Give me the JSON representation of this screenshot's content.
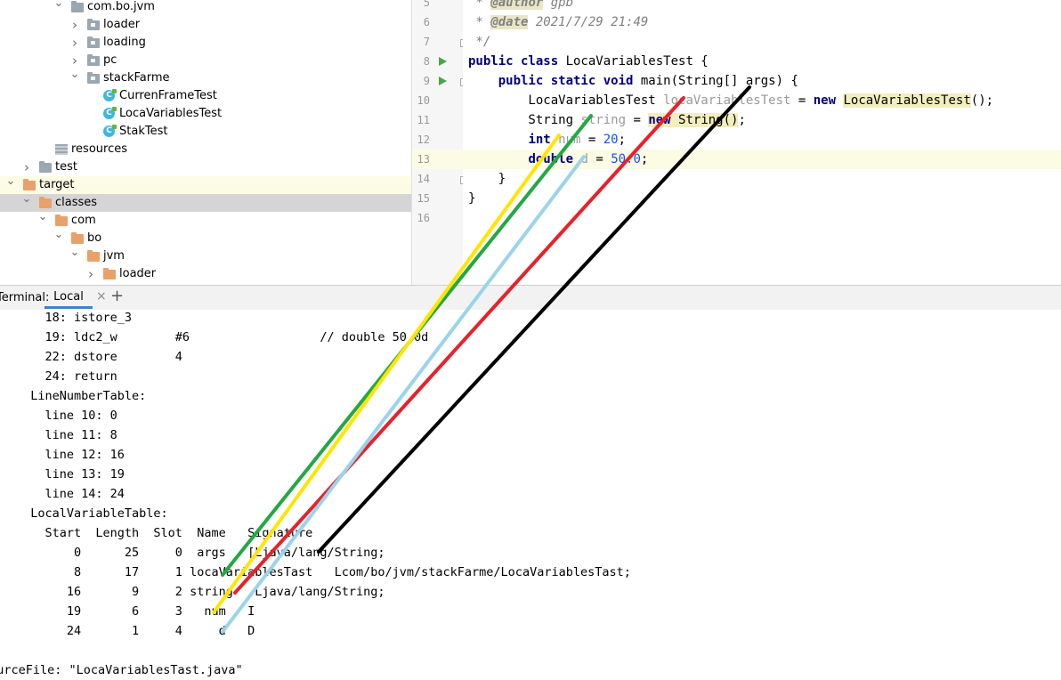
{
  "tree": [
    {
      "label": "com.bo.jvm",
      "depth": 0,
      "expanded": true,
      "icon": "folder-icon"
    },
    {
      "label": "loader",
      "depth": 1,
      "expanded": false,
      "icon": "package-icon"
    },
    {
      "label": "loading",
      "depth": 1,
      "expanded": false,
      "icon": "package-icon"
    },
    {
      "label": "pc",
      "depth": 1,
      "expanded": false,
      "icon": "package-icon"
    },
    {
      "label": "stackFarme",
      "depth": 1,
      "expanded": true,
      "icon": "package-icon"
    },
    {
      "label": "CurrenFrameTest",
      "depth": 2,
      "icon": "class-icon"
    },
    {
      "label": "LocaVariablesTest",
      "depth": 2,
      "icon": "class-icon"
    },
    {
      "label": "StakTest",
      "depth": 2,
      "icon": "class-icon"
    },
    {
      "label": "resources",
      "depth": -1,
      "icon": "resources-icon"
    },
    {
      "label": "test",
      "depth": -2,
      "expanded": false,
      "icon": "folder-icon"
    },
    {
      "label": "target",
      "depth": -3,
      "expanded": true,
      "icon": "folder-orange-icon"
    },
    {
      "label": "classes",
      "depth": -2,
      "expanded": true,
      "icon": "folder-orange-icon"
    },
    {
      "label": "com",
      "depth": -1,
      "expanded": true,
      "icon": "folder-orange-icon"
    },
    {
      "label": "bo",
      "depth": 0,
      "expanded": true,
      "icon": "folder-orange-icon"
    },
    {
      "label": "jvm",
      "depth": 1,
      "expanded": true,
      "icon": "folder-orange-icon"
    },
    {
      "label": "loader",
      "depth": 2,
      "expanded": false,
      "icon": "folder-orange-icon"
    }
  ],
  "editor": {
    "line_numbers": [
      "5",
      "6",
      "7",
      "8",
      "9",
      "10",
      "11",
      "12",
      "13",
      "14",
      "15",
      "16"
    ],
    "current_line": "13",
    "lines": [
      [
        {
          "t": " * ",
          "c": "cmt"
        },
        {
          "t": "@author",
          "c": "tag"
        },
        {
          "t": " gpb",
          "c": "cmt"
        }
      ],
      [
        {
          "t": " * ",
          "c": "cmt"
        },
        {
          "t": "@date",
          "c": "tag"
        },
        {
          "t": " 2021/7/29 21:49",
          "c": "cmt"
        }
      ],
      [
        {
          "t": " */",
          "c": "cmt"
        }
      ],
      [
        {
          "t": "public class ",
          "c": "kw"
        },
        {
          "t": "LocaVariablesTest {",
          "c": ""
        }
      ],
      [
        {
          "t": "    "
        },
        {
          "t": "public static void ",
          "c": "kw"
        },
        {
          "t": "main(String[] args) {"
        }
      ],
      [
        {
          "t": "        LocaVariablesTest "
        },
        {
          "t": "locaVariablesTest",
          "c": "unused"
        },
        {
          "t": " = "
        },
        {
          "t": "new ",
          "c": "kw"
        },
        {
          "t": "LocaVariablesTest",
          "c": "hlcls"
        },
        {
          "t": "();"
        }
      ],
      [
        {
          "t": "        String "
        },
        {
          "t": "string",
          "c": "unused"
        },
        {
          "t": " = "
        },
        {
          "t": "new ",
          "c": "kw hlcls"
        },
        {
          "t": "String()",
          "c": "hlcls"
        },
        {
          "t": ";"
        }
      ],
      [
        {
          "t": "        "
        },
        {
          "t": "int ",
          "c": "kw"
        },
        {
          "t": "num",
          "c": "unused"
        },
        {
          "t": " = "
        },
        {
          "t": "20",
          "c": "num"
        },
        {
          "t": ";"
        }
      ],
      [
        {
          "t": "        "
        },
        {
          "t": "double ",
          "c": "kw"
        },
        {
          "t": "d",
          "c": "unused"
        },
        {
          "t": " = "
        },
        {
          "t": "50.0",
          "c": "num"
        },
        {
          "t": ";"
        }
      ],
      [
        {
          "t": "    }"
        }
      ],
      [
        {
          "t": "}"
        }
      ],
      [
        {
          "t": ""
        }
      ]
    ]
  },
  "terminal_tabs": {
    "label": "Terminal:",
    "tab": "Local",
    "close": "×",
    "add": "+"
  },
  "terminal": [
    "    18: istore_3",
    "    19: ldc2_w        #6                  // double 50.0d",
    "    22: dstore        4",
    "    24: return",
    "  LineNumberTable:",
    "    line 10: 0",
    "    line 11: 8",
    "    line 12: 16",
    "    line 13: 19",
    "    line 14: 24",
    "  LocalVariableTable:",
    "    Start  Length  Slot  Name   Signature",
    "        0      25     0  args   [Ljava/lang/String;",
    "        8      17     1 locaVariablesTast   Lcom/bo/jvm/stackFarme/LocaVariablesTast;",
    "       16       9     2 string   Ljava/lang/String;",
    "       19       6     3   num   I",
    "       24       1     4     d   D",
    "",
    "SourceFile: \"LocaVariablesTast.java\""
  ],
  "annotation_colors": {
    "black": "#000000",
    "red": "#e8212a",
    "green": "#23a843",
    "yellow": "#ffe500",
    "lightblue": "#9ad4ea"
  }
}
